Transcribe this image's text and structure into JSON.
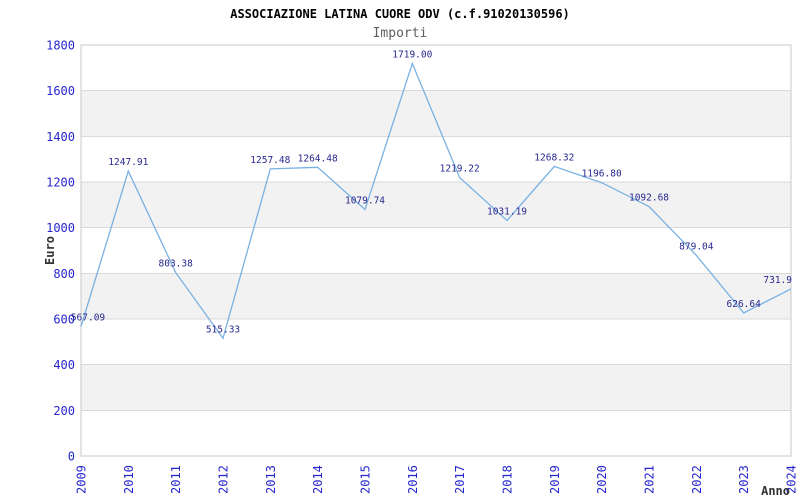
{
  "header": {
    "title": "ASSOCIAZIONE LATINA CUORE ODV (c.f.91020130596)",
    "subtitle": "Importi"
  },
  "chart_data": {
    "type": "line",
    "title": "ASSOCIAZIONE LATINA CUORE ODV (c.f.91020130596)",
    "subtitle": "Importi",
    "xlabel": "Anno",
    "ylabel": "Euro",
    "x": [
      "2009",
      "2010",
      "2011",
      "2012",
      "2013",
      "2014",
      "2015",
      "2016",
      "2017",
      "2018",
      "2019",
      "2020",
      "2021",
      "2022",
      "2023",
      "2024"
    ],
    "series": [
      {
        "name": "Importi",
        "values": [
          567.09,
          1247.91,
          803.38,
          515.33,
          1257.48,
          1264.48,
          1079.74,
          1719.0,
          1219.22,
          1031.19,
          1268.32,
          1196.8,
          1092.68,
          879.04,
          626.64,
          731.9
        ]
      }
    ],
    "point_labels": [
      "567.09",
      "1247.91",
      "803.38",
      "515.33",
      "1257.48",
      "1264.48",
      "1079.74",
      "1719.00",
      "1219.22",
      "1031.19",
      "1268.32",
      "1196.80",
      "1092.68",
      "879.04",
      "626.64",
      "731.9"
    ],
    "ylim": [
      0,
      1800
    ],
    "ytick_step": 200,
    "ytick_labels": [
      "0",
      "200",
      "400",
      "600",
      "800",
      "1000",
      "1200",
      "1400",
      "1600",
      "1800"
    ],
    "grid": true,
    "banding": "alternating horizontal bands, gray between 1600-1400, 1200-1000, 800-600, 400-200",
    "legend": "none",
    "markers": "none",
    "colors": {
      "line": "#79b1e3",
      "data_label": "#28288f",
      "tick_label": "#2626cd",
      "band_fill": "#f2f2f2",
      "gridline": "#dadada",
      "plot_border": "#c8c8c8",
      "title": "#000000",
      "subtitle": "#5f5f5f",
      "axis_title": "#333333",
      "background": "#ffffff"
    }
  }
}
